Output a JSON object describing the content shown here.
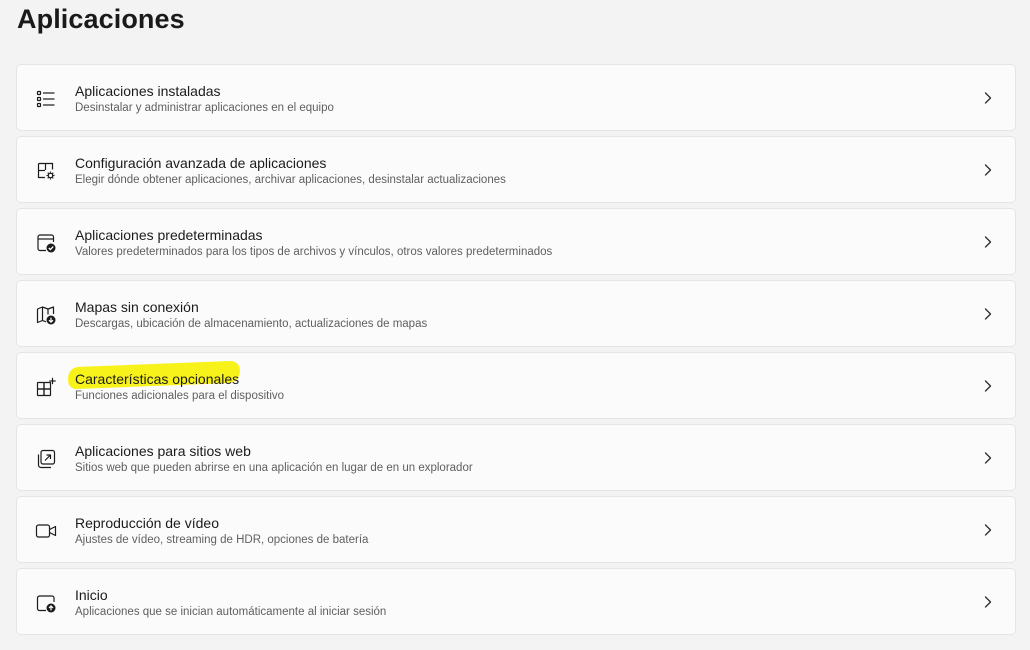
{
  "page": {
    "title": "Aplicaciones"
  },
  "items": [
    {
      "title": "Aplicaciones instaladas",
      "subtitle": "Desinstalar y administrar aplicaciones en el equipo",
      "icon": "installed-apps-list-icon"
    },
    {
      "title": "Configuración avanzada de aplicaciones",
      "subtitle": "Elegir dónde obtener aplicaciones, archivar aplicaciones, desinstalar actualizaciones",
      "icon": "advanced-app-settings-icon"
    },
    {
      "title": "Aplicaciones predeterminadas",
      "subtitle": "Valores predeterminados para los tipos de archivos y vínculos, otros valores predeterminados",
      "icon": "default-apps-icon"
    },
    {
      "title": "Mapas sin conexión",
      "subtitle": "Descargas, ubicación de almacenamiento, actualizaciones de mapas",
      "icon": "offline-maps-icon"
    },
    {
      "title": "Características opcionales",
      "subtitle": "Funciones adicionales para el dispositivo",
      "icon": "optional-features-icon",
      "highlight_color": "#f7f21a"
    },
    {
      "title": "Aplicaciones para sitios web",
      "subtitle": "Sitios web que pueden abrirse en una aplicación en lugar de en un explorador",
      "icon": "apps-for-websites-icon"
    },
    {
      "title": "Reproducción de vídeo",
      "subtitle": "Ajustes de vídeo, streaming de HDR, opciones de batería",
      "icon": "video-playback-icon"
    },
    {
      "title": "Inicio",
      "subtitle": "Aplicaciones que se inician automáticamente al iniciar sesión",
      "icon": "startup-apps-icon"
    }
  ],
  "colors": {
    "background": "#f3f3f3",
    "card": "#fbfbfb",
    "card_border": "#e5e5e5",
    "highlight": "#f7f21a"
  }
}
